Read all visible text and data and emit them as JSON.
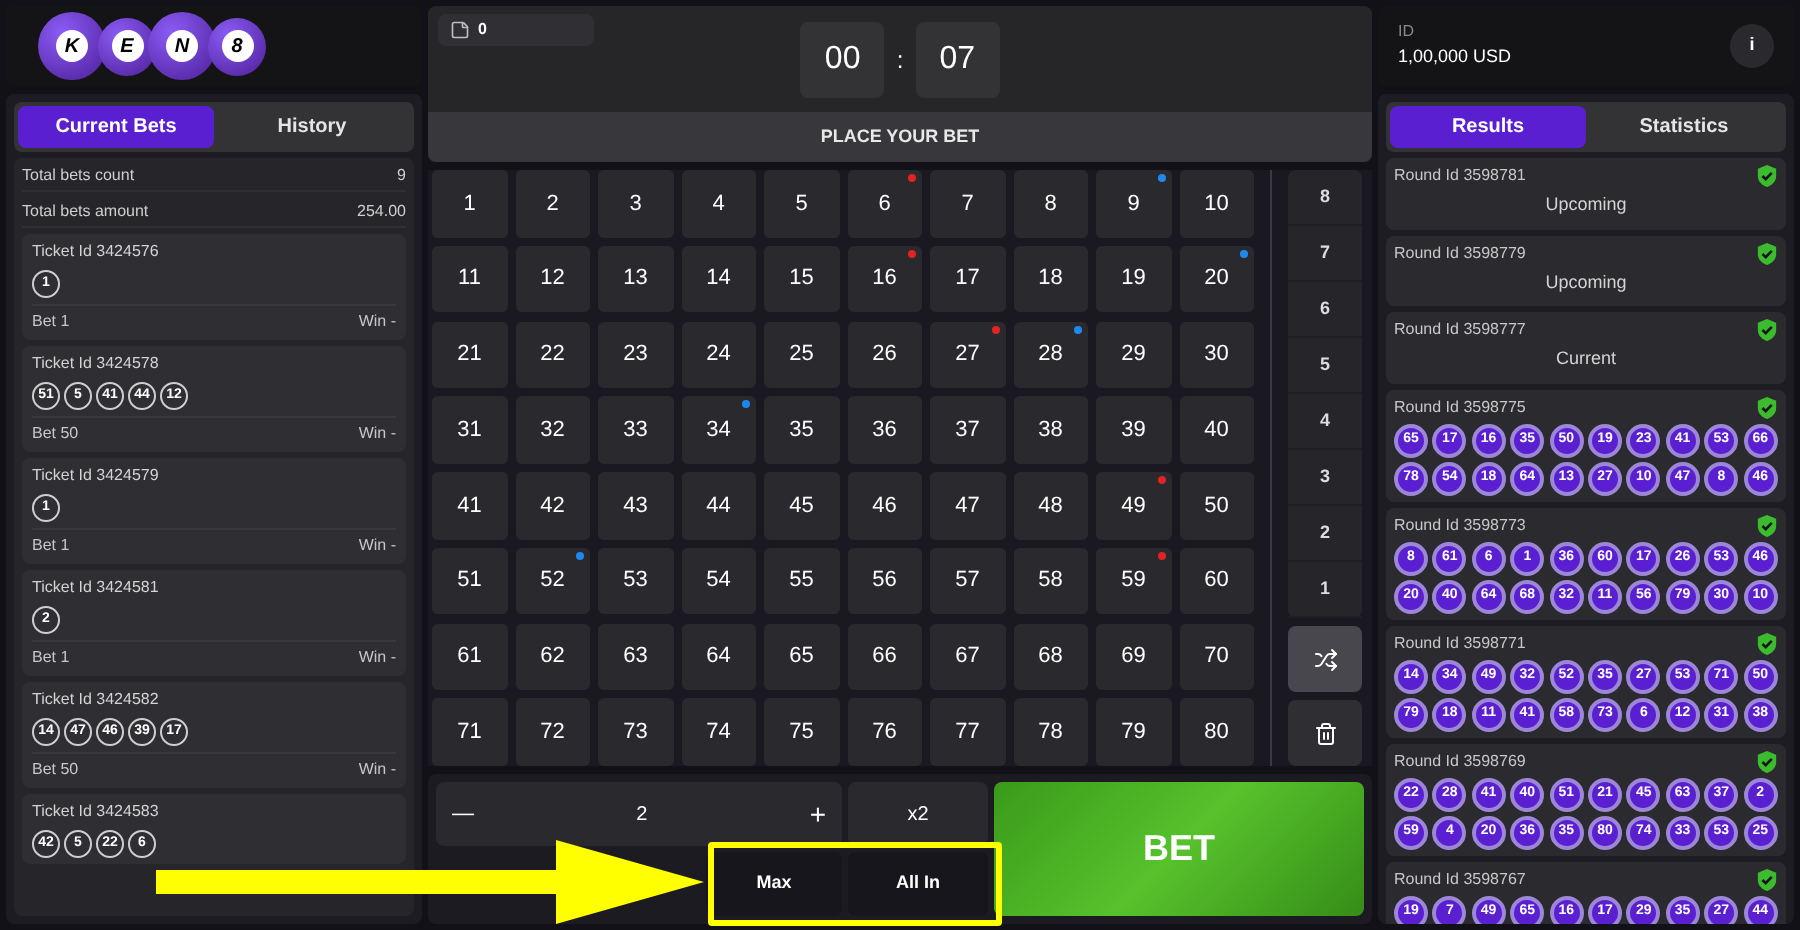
{
  "logo": [
    "K",
    "E",
    "N",
    "8"
  ],
  "left_tabs": [
    {
      "label": "Current Bets",
      "selected": true
    },
    {
      "label": "History",
      "selected": false
    }
  ],
  "totals": [
    {
      "label": "Total bets count",
      "value": "9"
    },
    {
      "label": "Total bets amount",
      "value": "254.00"
    }
  ],
  "tickets": [
    {
      "title": "Ticket Id 3424576",
      "numbers": [
        "1"
      ],
      "bet": "Bet 1",
      "win": "Win -"
    },
    {
      "title": "Ticket Id 3424578",
      "numbers": [
        "51",
        "5",
        "41",
        "44",
        "12"
      ],
      "bet": "Bet 50",
      "win": "Win -"
    },
    {
      "title": "Ticket Id 3424579",
      "numbers": [
        "1"
      ],
      "bet": "Bet 1",
      "win": "Win -"
    },
    {
      "title": "Ticket Id 3424581",
      "numbers": [
        "2"
      ],
      "bet": "Bet 1",
      "win": "Win -"
    },
    {
      "title": "Ticket Id 3424582",
      "numbers": [
        "14",
        "47",
        "46",
        "39",
        "17"
      ],
      "bet": "Bet 50",
      "win": "Win -"
    },
    {
      "title": "Ticket Id 3424583",
      "numbers": [
        "42",
        "5",
        "22",
        "6"
      ]
    }
  ],
  "ticket_count": "0",
  "timer": {
    "minutes": "00",
    "separator": ":",
    "seconds": "07"
  },
  "status_banner": "PLACE YOUR BET",
  "cells": [
    {
      "n": "1"
    },
    {
      "n": "2"
    },
    {
      "n": "3"
    },
    {
      "n": "4"
    },
    {
      "n": "5"
    },
    {
      "n": "6",
      "color": "#e02424"
    },
    {
      "n": "7"
    },
    {
      "n": "8"
    },
    {
      "n": "9",
      "color": "#1e88f0"
    },
    {
      "n": "10"
    },
    {
      "n": "11"
    },
    {
      "n": "12"
    },
    {
      "n": "13"
    },
    {
      "n": "14"
    },
    {
      "n": "15"
    },
    {
      "n": "16",
      "color": "#e02424"
    },
    {
      "n": "17"
    },
    {
      "n": "18"
    },
    {
      "n": "19"
    },
    {
      "n": "20",
      "color": "#1e88f0"
    },
    {
      "n": "21"
    },
    {
      "n": "22"
    },
    {
      "n": "23"
    },
    {
      "n": "24"
    },
    {
      "n": "25"
    },
    {
      "n": "26"
    },
    {
      "n": "27",
      "color": "#e02424"
    },
    {
      "n": "28",
      "color": "#1e88f0"
    },
    {
      "n": "29"
    },
    {
      "n": "30"
    },
    {
      "n": "31"
    },
    {
      "n": "32"
    },
    {
      "n": "33"
    },
    {
      "n": "34",
      "color": "#1e88f0"
    },
    {
      "n": "35"
    },
    {
      "n": "36"
    },
    {
      "n": "37"
    },
    {
      "n": "38"
    },
    {
      "n": "39"
    },
    {
      "n": "40"
    },
    {
      "n": "41"
    },
    {
      "n": "42"
    },
    {
      "n": "43"
    },
    {
      "n": "44"
    },
    {
      "n": "45"
    },
    {
      "n": "46"
    },
    {
      "n": "47"
    },
    {
      "n": "48"
    },
    {
      "n": "49",
      "color": "#e02424"
    },
    {
      "n": "50"
    },
    {
      "n": "51"
    },
    {
      "n": "52",
      "color": "#1e88f0"
    },
    {
      "n": "53"
    },
    {
      "n": "54"
    },
    {
      "n": "55"
    },
    {
      "n": "56"
    },
    {
      "n": "57"
    },
    {
      "n": "58"
    },
    {
      "n": "59",
      "color": "#e02424"
    },
    {
      "n": "60"
    },
    {
      "n": "61"
    },
    {
      "n": "62"
    },
    {
      "n": "63"
    },
    {
      "n": "64"
    },
    {
      "n": "65"
    },
    {
      "n": "66"
    },
    {
      "n": "67"
    },
    {
      "n": "68"
    },
    {
      "n": "69"
    },
    {
      "n": "70"
    },
    {
      "n": "71"
    },
    {
      "n": "72"
    },
    {
      "n": "73"
    },
    {
      "n": "74"
    },
    {
      "n": "75"
    },
    {
      "n": "76"
    },
    {
      "n": "77"
    },
    {
      "n": "78"
    },
    {
      "n": "79"
    },
    {
      "n": "80"
    }
  ],
  "quick_picks": [
    "8",
    "7",
    "6",
    "5",
    "4",
    "3",
    "2",
    "1"
  ],
  "stake": {
    "minus": "—",
    "value": "2",
    "plus": "+",
    "double": "x2",
    "max": "Max",
    "all_in": "All In"
  },
  "bet_button": "BET",
  "account": {
    "label": "ID",
    "balance": "1,00,000 USD",
    "info": "i"
  },
  "right_tabs": [
    {
      "label": "Results",
      "selected": true
    },
    {
      "label": "Statistics",
      "selected": false
    }
  ],
  "rounds": [
    {
      "title": "Round Id 3598781",
      "kind": "status",
      "status": "Upcoming"
    },
    {
      "title": "Round Id 3598779",
      "kind": "status",
      "status": "Upcoming"
    },
    {
      "title": "Round Id 3598777",
      "kind": "status",
      "status": "Current"
    },
    {
      "title": "Round Id 3598775",
      "kind": "balls",
      "numbers": [
        "65",
        "17",
        "16",
        "35",
        "50",
        "19",
        "23",
        "41",
        "53",
        "66",
        "78",
        "54",
        "18",
        "64",
        "13",
        "27",
        "10",
        "47",
        "8",
        "46"
      ]
    },
    {
      "title": "Round Id 3598773",
      "kind": "balls",
      "numbers": [
        "8",
        "61",
        "6",
        "1",
        "36",
        "60",
        "17",
        "26",
        "53",
        "46",
        "20",
        "40",
        "64",
        "68",
        "32",
        "11",
        "56",
        "79",
        "30",
        "10"
      ]
    },
    {
      "title": "Round Id 3598771",
      "kind": "balls",
      "numbers": [
        "14",
        "34",
        "49",
        "32",
        "52",
        "35",
        "27",
        "53",
        "71",
        "50",
        "79",
        "18",
        "11",
        "41",
        "58",
        "73",
        "6",
        "12",
        "31",
        "38"
      ]
    },
    {
      "title": "Round Id 3598769",
      "kind": "balls",
      "numbers": [
        "22",
        "28",
        "41",
        "40",
        "51",
        "21",
        "45",
        "63",
        "37",
        "2",
        "59",
        "4",
        "20",
        "36",
        "35",
        "80",
        "74",
        "33",
        "53",
        "25"
      ]
    },
    {
      "title": "Round Id 3598767",
      "kind": "balls",
      "numbers": [
        "19",
        "7",
        "49",
        "65",
        "16",
        "17",
        "29",
        "35",
        "27",
        "44"
      ]
    }
  ]
}
